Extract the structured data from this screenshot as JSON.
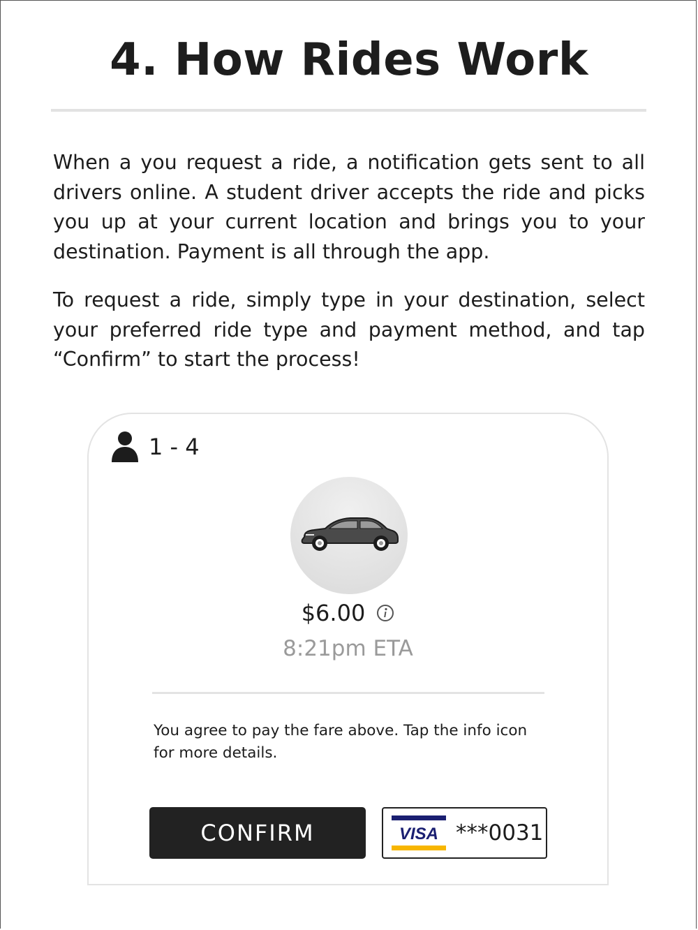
{
  "page": {
    "title": "4. How Rides Work",
    "paragraphs": [
      "When a you request a ride, a notification gets sent to all drivers online. A student driver accepts the ride and picks you up at your current location and brings you to your destination. Payment is all through the app.",
      "To request a ride, simply type in your destination, select your preferred ride type and payment method, and tap “Confirm” to start the process!"
    ]
  },
  "ride_card": {
    "capacity_icon": "person-icon",
    "capacity": "1 - 4",
    "vehicle_icon": "car-icon",
    "price": "$6.00",
    "info_icon": "info-icon",
    "eta": "8:21pm ETA",
    "agreement": "You agree to pay the fare above. Tap the info icon for more details.",
    "confirm_label": "CONFIRM",
    "payment": {
      "brand": "VISA",
      "card_number": "***0031"
    }
  },
  "colors": {
    "button_bg": "#222222",
    "muted_text": "#9a9a9a",
    "divider": "#e3e3e3",
    "visa_blue": "#1a1f71",
    "visa_gold": "#f7b600"
  }
}
